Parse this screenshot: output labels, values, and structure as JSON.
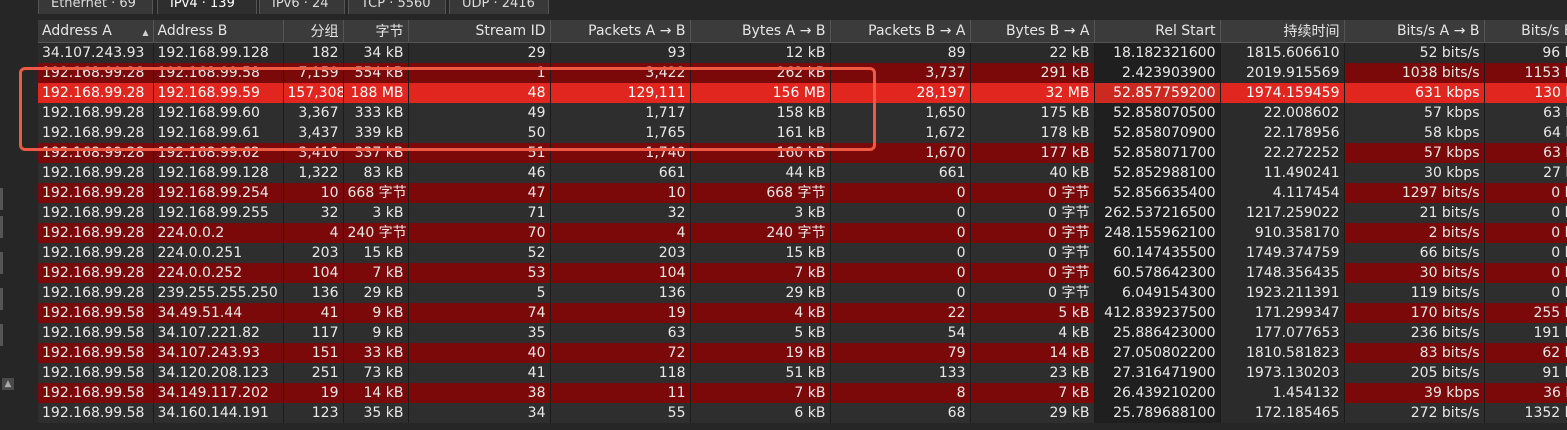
{
  "tabs": [
    "Ethernet · 69",
    "IPv4 · 139",
    "IPv6 · 24",
    "TCP · 5560",
    "UDP · 2416"
  ],
  "columns": [
    "Address A",
    "Address B",
    "分组",
    "字节",
    "Stream ID",
    "Packets A → B",
    "Bytes A → B",
    "Packets B → A",
    "Bytes B → A",
    "Rel Start",
    "持续时间",
    "Bits/s A → B",
    "Bits/s B"
  ],
  "rows": [
    [
      "34.107.243.93",
      "192.168.99.128",
      "182",
      "34 kB",
      "29",
      "93",
      "12 kB",
      "89",
      "22 kB",
      "18.182321600",
      "1815.606610",
      "52 bits/s",
      "96 b"
    ],
    [
      "192.168.99.28",
      "192.168.99.58",
      "7,159",
      "554 kB",
      "1",
      "3,422",
      "262 kB",
      "3,737",
      "291 kB",
      "2.423903900",
      "2019.915569",
      "1038 bits/s",
      "1153 b"
    ],
    [
      "192.168.99.28",
      "192.168.99.59",
      "157,308",
      "188 MB",
      "48",
      "129,111",
      "156 MB",
      "28,197",
      "32 MB",
      "52.857759200",
      "1974.159459",
      "631 kbps",
      "130 k"
    ],
    [
      "192.168.99.28",
      "192.168.99.60",
      "3,367",
      "333 kB",
      "49",
      "1,717",
      "158 kB",
      "1,650",
      "175 kB",
      "52.858070500",
      "22.008602",
      "57 kbps",
      "63 k"
    ],
    [
      "192.168.99.28",
      "192.168.99.61",
      "3,437",
      "339 kB",
      "50",
      "1,765",
      "161 kB",
      "1,672",
      "178 kB",
      "52.858070900",
      "22.178956",
      "58 kbps",
      "64 k"
    ],
    [
      "192.168.99.28",
      "192.168.99.62",
      "3,410",
      "337 kB",
      "51",
      "1,740",
      "160 kB",
      "1,670",
      "177 kB",
      "52.858071700",
      "22.272252",
      "57 kbps",
      "63 k"
    ],
    [
      "192.168.99.28",
      "192.168.99.128",
      "1,322",
      "83 kB",
      "46",
      "661",
      "44 kB",
      "661",
      "40 kB",
      "52.852988100",
      "11.490241",
      "30 kbps",
      "27 k"
    ],
    [
      "192.168.99.28",
      "192.168.99.254",
      "10",
      "668 字节",
      "47",
      "10",
      "668 字节",
      "0",
      "0 字节",
      "52.856635400",
      "4.117454",
      "1297 bits/s",
      "0 b"
    ],
    [
      "192.168.99.28",
      "192.168.99.255",
      "32",
      "3 kB",
      "71",
      "32",
      "3 kB",
      "0",
      "0 字节",
      "262.537216500",
      "1217.259022",
      "21 bits/s",
      "0 b"
    ],
    [
      "192.168.99.28",
      "224.0.0.2",
      "4",
      "240 字节",
      "70",
      "4",
      "240 字节",
      "0",
      "0 字节",
      "248.155962100",
      "910.358170",
      "2 bits/s",
      "0 b"
    ],
    [
      "192.168.99.28",
      "224.0.0.251",
      "203",
      "15 kB",
      "52",
      "203",
      "15 kB",
      "0",
      "0 字节",
      "60.147435500",
      "1749.374759",
      "66 bits/s",
      "0 b"
    ],
    [
      "192.168.99.28",
      "224.0.0.252",
      "104",
      "7 kB",
      "53",
      "104",
      "7 kB",
      "0",
      "0 字节",
      "60.578642300",
      "1748.356435",
      "30 bits/s",
      "0 b"
    ],
    [
      "192.168.99.28",
      "239.255.255.250",
      "136",
      "29 kB",
      "5",
      "136",
      "29 kB",
      "0",
      "0 字节",
      "6.049154300",
      "1923.211391",
      "119 bits/s",
      "0 b"
    ],
    [
      "192.168.99.58",
      "34.49.51.44",
      "41",
      "9 kB",
      "74",
      "19",
      "4 kB",
      "22",
      "5 kB",
      "412.839237500",
      "171.299347",
      "170 bits/s",
      "255 b"
    ],
    [
      "192.168.99.58",
      "34.107.221.82",
      "117",
      "9 kB",
      "35",
      "63",
      "5 kB",
      "54",
      "4 kB",
      "25.886423000",
      "177.077653",
      "236 bits/s",
      "191 b"
    ],
    [
      "192.168.99.58",
      "34.107.243.93",
      "151",
      "33 kB",
      "40",
      "72",
      "19 kB",
      "79",
      "14 kB",
      "27.050802200",
      "1810.581823",
      "83 bits/s",
      "62 b"
    ],
    [
      "192.168.99.58",
      "34.120.208.123",
      "251",
      "73 kB",
      "41",
      "118",
      "51 kB",
      "133",
      "23 kB",
      "27.316471900",
      "1973.130203",
      "205 bits/s",
      "91 b"
    ],
    [
      "192.168.99.58",
      "34.149.117.202",
      "19",
      "14 kB",
      "38",
      "11",
      "7 kB",
      "8",
      "7 kB",
      "26.439210200",
      "1.454132",
      "39 kbps",
      "36 k"
    ],
    [
      "192.168.99.58",
      "34.160.144.191",
      "123",
      "35 kB",
      "34",
      "55",
      "6 kB",
      "68",
      "29 kB",
      "25.789688100",
      "172.185465",
      "272 bits/s",
      "1352 b"
    ]
  ],
  "row_styles": [
    "first",
    "red",
    "hi",
    "dark",
    "dark",
    "red",
    "dark",
    "red",
    "dark",
    "red",
    "dark",
    "red",
    "dark",
    "red",
    "dark",
    "red",
    "dark",
    "red",
    "dark"
  ],
  "sorted_column": "Address A",
  "colors": {
    "highlight_row": "#e0261e",
    "dark_red_row": "#7b0909",
    "dark_row": "#2e2e2e",
    "callout_box": "#ee5a44"
  }
}
